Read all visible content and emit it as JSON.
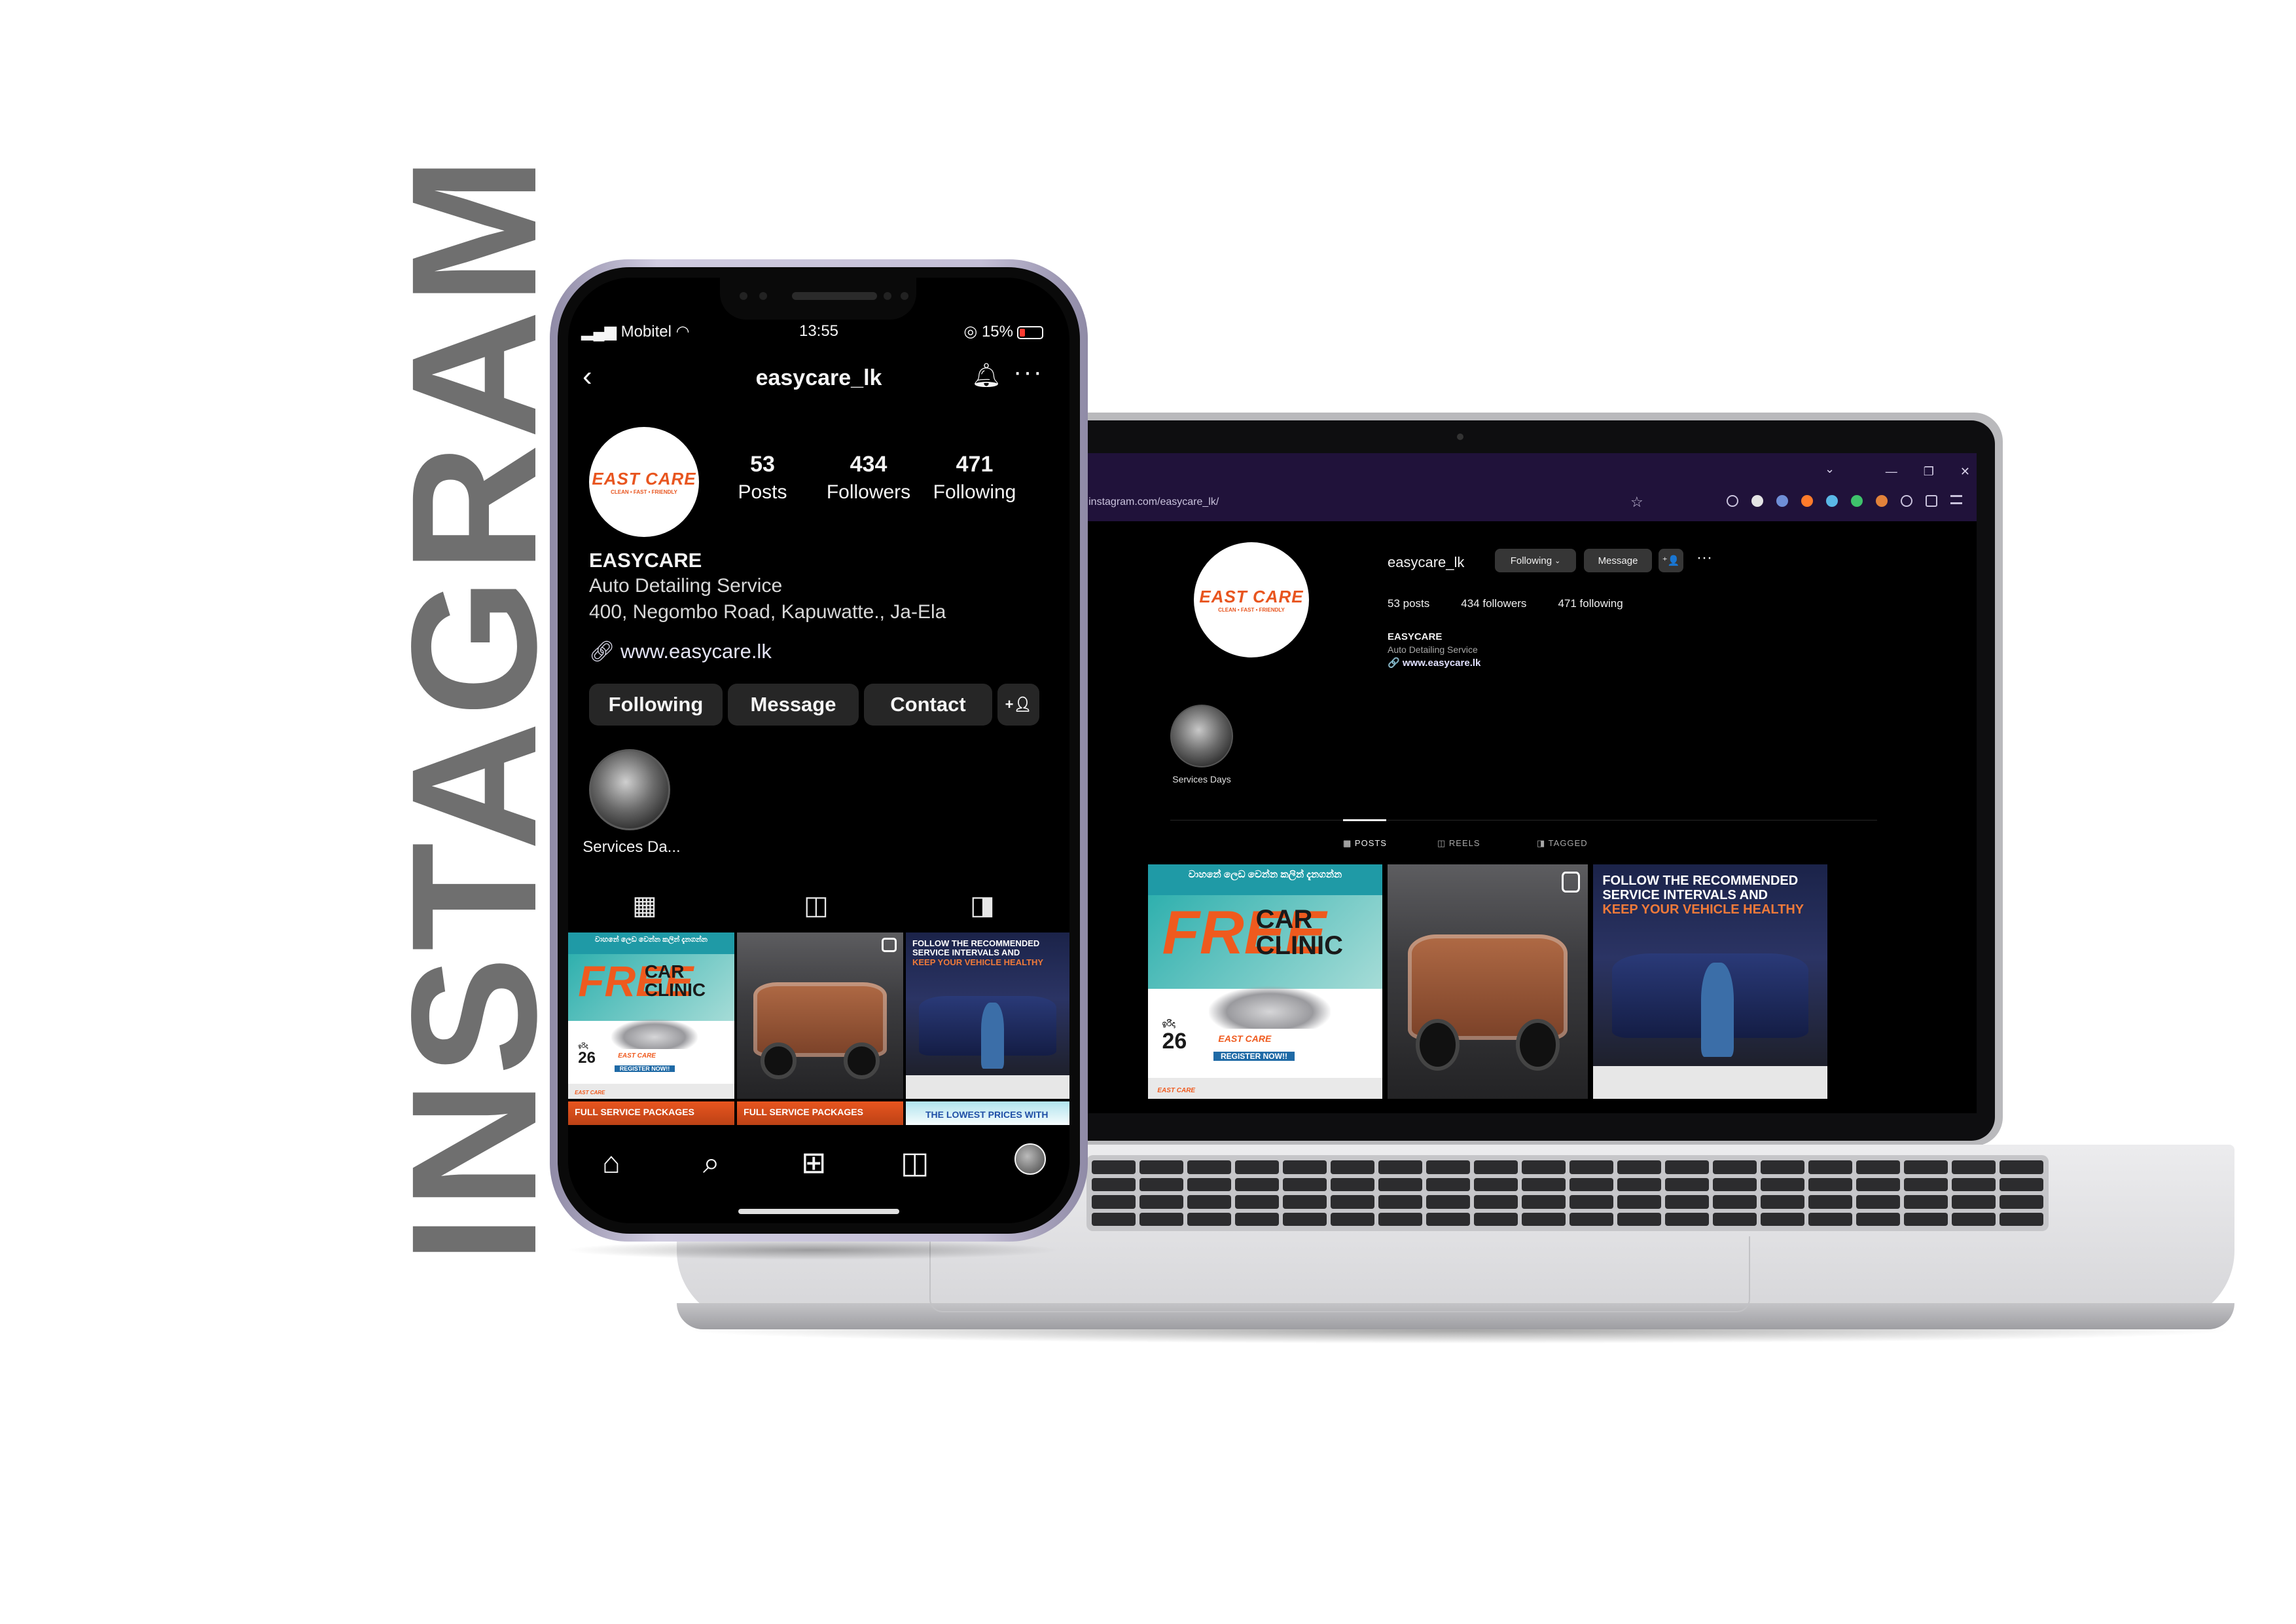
{
  "headline": "INSTAGRAM",
  "brand": {
    "logo_text": "EAST CARE",
    "logo_tagline": "CLEAN • FAST • FRIENDLY",
    "accent_color": "#e8551f"
  },
  "phone": {
    "status": {
      "carrier": "Mobitel",
      "time": "13:55",
      "battery": "15%"
    },
    "header": {
      "username": "easycare_lk"
    },
    "stats": [
      {
        "value": "53",
        "label": "Posts"
      },
      {
        "value": "434",
        "label": "Followers"
      },
      {
        "value": "471",
        "label": "Following"
      }
    ],
    "bio": {
      "name": "EASYCARE",
      "category": "Auto Detailing Service",
      "address": "400, Negombo Road, Kapuwatte., Ja-Ela",
      "website": "www.easycare.lk"
    },
    "buttons": {
      "following": "Following",
      "message": "Message",
      "contact": "Contact"
    },
    "highlight": {
      "label": "Services Da..."
    }
  },
  "laptop": {
    "url": "w.instagram.com/easycare_lk/",
    "username": "easycare_lk",
    "buttons": {
      "following": "Following",
      "message": "Message"
    },
    "stats": {
      "posts": "53 posts",
      "followers": "434 followers",
      "following": "471 following"
    },
    "bio": {
      "name": "EASYCARE",
      "category": "Auto Detailing Service",
      "website": "www.easycare.lk"
    },
    "highlight": {
      "label": "Services Days"
    },
    "tabs": {
      "posts": "POSTS",
      "reels": "REELS",
      "tagged": "TAGGED"
    }
  },
  "posts": {
    "clinic": {
      "top_text": "වාහනේ ලෙඩ වෙන්න කලින් දැනගන්න",
      "free": "FREE",
      "clinic": "CAR CLINIC",
      "date_label": "ඉරිදා",
      "date": "26",
      "register": "REGISTER NOW!!"
    },
    "service": {
      "line1": "FOLLOW THE RECOMMENDED",
      "line2": "SERVICE INTERVALS AND",
      "line3": "KEEP YOUR VEHICLE HEALTHY"
    },
    "packages": "FULL SERVICE PACKAGES",
    "prices": "THE LOWEST PRICES WITH"
  }
}
